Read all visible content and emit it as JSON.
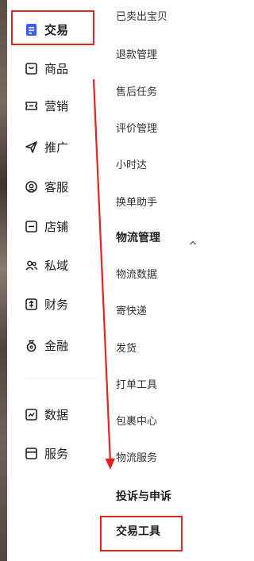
{
  "primary_nav": [
    {
      "label": "交易",
      "icon": "order-icon"
    },
    {
      "label": "商品",
      "icon": "product-icon"
    },
    {
      "label": "营销",
      "icon": "ticket-icon"
    },
    {
      "label": "推广",
      "icon": "send-icon"
    },
    {
      "label": "客服",
      "icon": "headset-icon"
    },
    {
      "label": "店铺",
      "icon": "store-icon"
    },
    {
      "label": "私域",
      "icon": "users-icon"
    },
    {
      "label": "财务",
      "icon": "finance-icon"
    },
    {
      "label": "金融",
      "icon": "money-bag-icon"
    },
    {
      "label": "数据",
      "icon": "chart-icon"
    },
    {
      "label": "服务",
      "icon": "service-icon"
    }
  ],
  "sub_nav": {
    "items_top": [
      "已卖出宝贝",
      "退款管理",
      "售后任务",
      "评价管理",
      "小时达",
      "换单助手"
    ],
    "group_logistics": "物流管理",
    "items_logistics": [
      "物流数据",
      "寄快递",
      "发货",
      "打单工具",
      "包裹中心",
      "物流服务"
    ],
    "group_complaints": "投诉与申诉",
    "group_trade_tools": "交易工具"
  },
  "colors": {
    "highlight": "#e02424",
    "active_icon": "#3b5bfd"
  }
}
